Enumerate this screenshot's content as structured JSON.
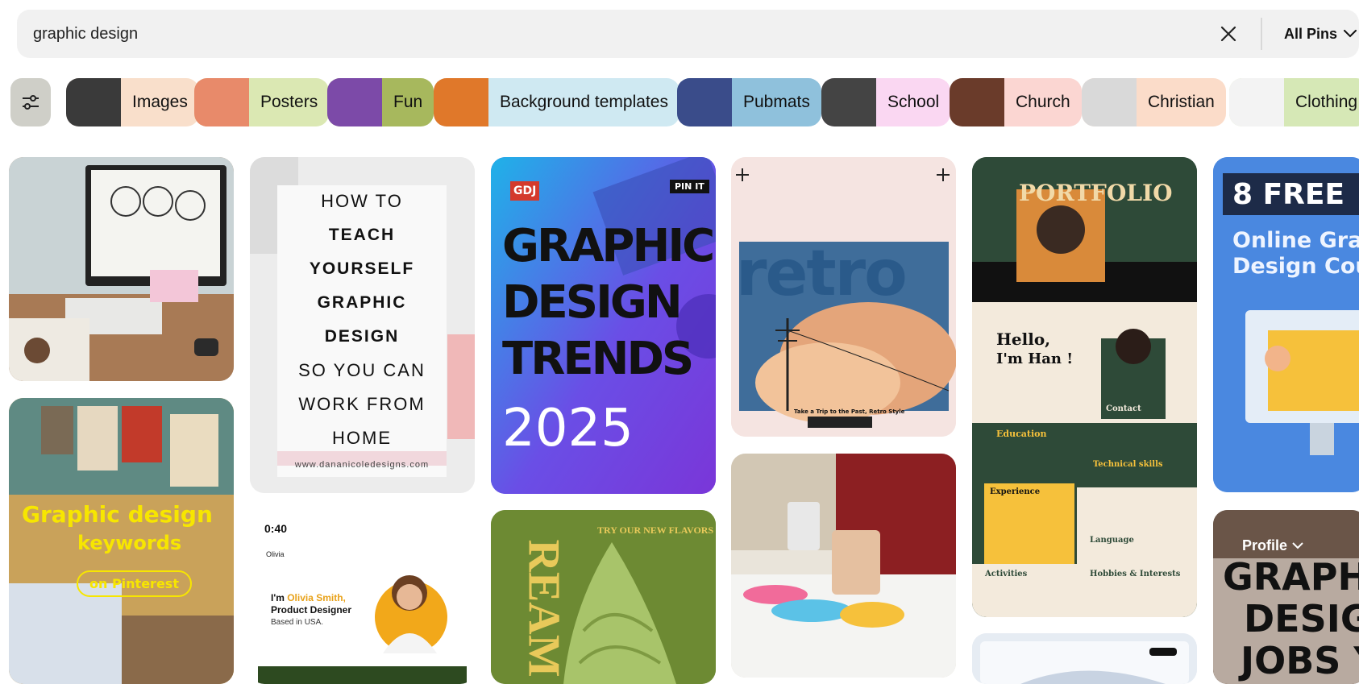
{
  "search": {
    "query": "graphic design",
    "filter_label": "All Pins"
  },
  "chips": [
    {
      "label": "Images",
      "bg": "#f9dfcb",
      "thumb": "#3a3a3a"
    },
    {
      "label": "Posters",
      "bg": "#dbe8b3",
      "thumb": "#e88a6a"
    },
    {
      "label": "Fun",
      "bg": "#a7b85d",
      "thumb": "#7c4aa8"
    },
    {
      "label": "Background templates",
      "bg": "#cfe9f2",
      "thumb": "#e0782a"
    },
    {
      "label": "Pubmats",
      "bg": "#8fc1dc",
      "thumb": "#3a4c8a"
    },
    {
      "label": "School",
      "bg": "#fad7f2",
      "thumb": "#444"
    },
    {
      "label": "Church",
      "bg": "#fbd6d2",
      "thumb": "#6a3b2a"
    },
    {
      "label": "Christian",
      "bg": "#fbdcc9",
      "thumb": "#d9d9d9"
    },
    {
      "label": "Clothing",
      "bg": "#d6e8b6",
      "thumb": "#f3f3f3"
    }
  ],
  "pins": {
    "p1": {
      "bg": "#b58a65"
    },
    "p2": {
      "bg": "#c9a25a",
      "line1": "Graphic design",
      "line2": "keywords",
      "line3": "on Pinterest"
    },
    "p3": {
      "bg": "#ededed",
      "lines": [
        "HOW TO",
        "TEACH",
        "YOURSELF",
        "GRAPHIC",
        "DESIGN",
        "SO YOU CAN",
        "WORK FROM",
        "HOME"
      ],
      "url": "www.dananicoledesigns.com"
    },
    "p4": {
      "bg": "#ffffff",
      "duration": "0:40",
      "name_pre": "I'm ",
      "name": "Olivia Smith,",
      "role": "Product Designer",
      "based": "Based in USA.",
      "logo": "Olivia"
    },
    "p5": {
      "bg": "#5d4ce0",
      "badge": "GDJ",
      "pin_it": "PIN IT",
      "line1": "GRAPHIC",
      "line2": "DESIGN",
      "line3": "TRENDS",
      "line4": "2025"
    },
    "p6": {
      "bg": "#6d8a33",
      "promo": "TRY OUR NEW FLAVORS",
      "side": "REAM"
    },
    "p7": {
      "bg": "#f5e4e1",
      "word": "retro",
      "caption": "Take a Trip to the Past, Retro Style"
    },
    "p8": {
      "bg": "#d9d4ca"
    },
    "p9": {
      "bg": "#2e4a38",
      "title": "PORTFOLIO",
      "hello": "Hello,",
      "name": "I'm Han !",
      "education": "Education",
      "experience": "Experience",
      "skills": "Technical skills",
      "contact": "Contact",
      "language": "Language",
      "activities": "Activities",
      "hobbies": "Hobbies & Interests"
    },
    "p10": {
      "bg": "#e6ecf3"
    },
    "p11": {
      "bg": "#4a88e0",
      "title": "8 FREE",
      "sub1": "Online Gra",
      "sub2": "Design Cou"
    },
    "p12": {
      "bg": "#6a5548",
      "profile": "Profile",
      "line1": "GRAPH",
      "line2": "DESIG",
      "line3": "JOBS Y"
    }
  }
}
